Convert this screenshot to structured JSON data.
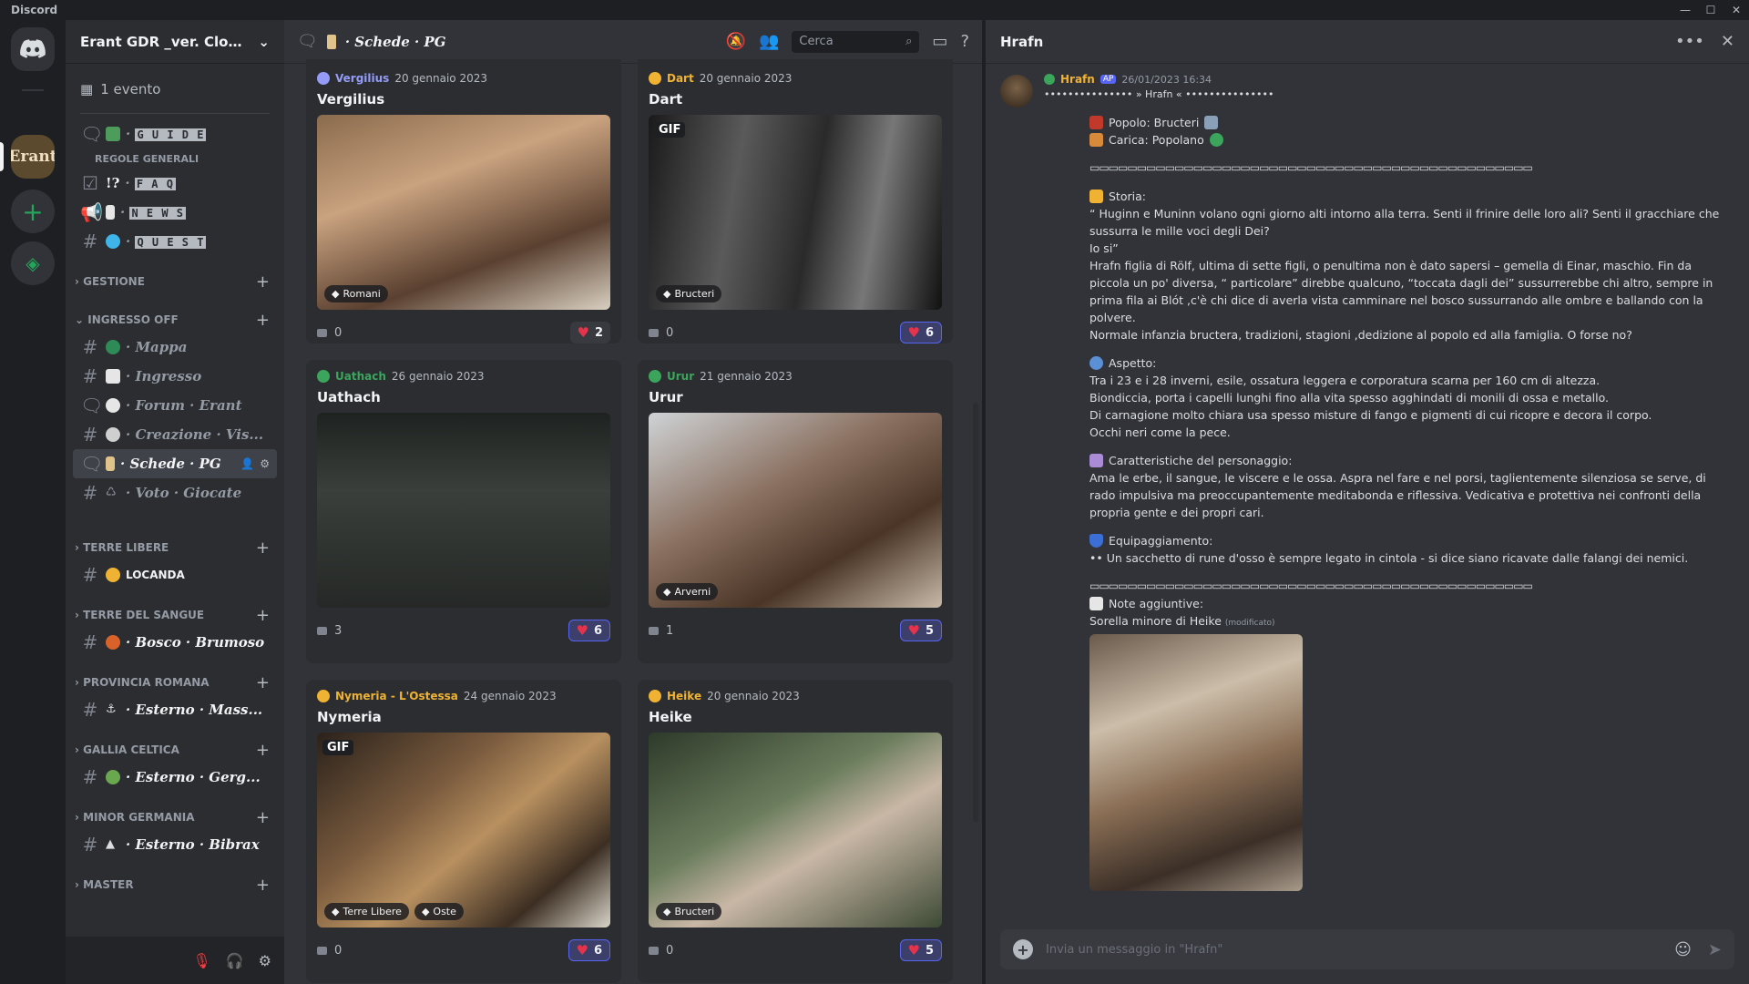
{
  "app": {
    "name": "Discord"
  },
  "window_controls": [
    "—",
    "☐",
    "✕"
  ],
  "server_sidebar": {
    "active_server_label": "Erant"
  },
  "guild": {
    "name": "Erant GDR _ver. Closed_...",
    "event": "1 evento"
  },
  "channels": {
    "top": [
      {
        "id": "guide",
        "label": "G U I D E",
        "sub": "REGOLE GENERALI"
      },
      {
        "id": "faq",
        "label": "F A Q",
        "prefix": "!?"
      },
      {
        "id": "news",
        "label": "N E W S"
      },
      {
        "id": "quest",
        "label": "Q U E S T"
      }
    ],
    "categories": [
      {
        "id": "gestione",
        "label": "GESTIONE",
        "items": []
      },
      {
        "id": "ingresso",
        "label": "INGRESSO OFF",
        "items": [
          {
            "label": "· Mappa",
            "type": "text"
          },
          {
            "label": "· Ingresso",
            "type": "text"
          },
          {
            "label": "· Forum · Erant",
            "type": "forum"
          },
          {
            "label": "· Creazione · Vis...",
            "type": "text"
          },
          {
            "label": "· Schede · PG",
            "type": "forum",
            "selected": true
          },
          {
            "label": "· Voto · Giocate",
            "type": "text"
          }
        ]
      },
      {
        "id": "terre-libere",
        "label": "TERRE LIBERE",
        "items": [
          {
            "label": "LOCANDA",
            "type": "text",
            "plain": true
          }
        ]
      },
      {
        "id": "terre-sangue",
        "label": "TERRE DEL SANGUE",
        "items": [
          {
            "label": "· Bosco · Brumoso",
            "type": "text"
          }
        ]
      },
      {
        "id": "provincia",
        "label": "PROVINCIA ROMANA",
        "items": [
          {
            "label": "· Esterno · Mass...",
            "type": "text"
          }
        ]
      },
      {
        "id": "gallia",
        "label": "GALLIA CELTICA",
        "items": [
          {
            "label": "· Esterno · Gerg...",
            "type": "text"
          }
        ]
      },
      {
        "id": "germania",
        "label": "MINOR GERMANIA",
        "items": [
          {
            "label": "· Esterno · Bibrax",
            "type": "text"
          }
        ]
      },
      {
        "id": "master",
        "label": "MASTER",
        "items": []
      }
    ]
  },
  "forum": {
    "title": "· Schede · PG",
    "search_placeholder": "Cerca",
    "posts": [
      {
        "author": "Vergilius",
        "author_color": "#949cf7",
        "date": "20 gennaio 2023",
        "title": "Vergilius",
        "tags": [
          "Romani"
        ],
        "comments": "0",
        "reactions": "2",
        "reacted": false,
        "gif": false,
        "img": "linear-gradient(160deg,#8a6b4d 0%,#c9a27f 35%,#5a4030 70%,#d8cfc0 100%)"
      },
      {
        "author": "Dart",
        "author_color": "#f0b232",
        "date": "20 gennaio 2023",
        "title": "Dart",
        "tags": [
          "Bructeri"
        ],
        "comments": "0",
        "reactions": "6",
        "reacted": true,
        "gif": true,
        "img": "linear-gradient(100deg,#1a1a1a 0%,#5a5a5a 30%,#2a2a2a 55%,#777 75%,#111 100%)"
      },
      {
        "author": "Uathach",
        "author_color": "#3ba55c",
        "date": "26 gennaio 2023",
        "title": "Uathach",
        "tags": [],
        "comments": "3",
        "reactions": "6",
        "reacted": true,
        "gif": false,
        "img": "linear-gradient(180deg,#1e2220 0%,#3a3f3b 40%,#252826 100%)"
      },
      {
        "author": "Urur",
        "author_color": "#3ba55c",
        "date": "21 gennaio 2023",
        "title": "Urur",
        "tags": [
          "Arverni"
        ],
        "comments": "1",
        "reactions": "5",
        "reacted": true,
        "gif": false,
        "img": "linear-gradient(150deg,#cfd3d6 0%,#8a7060 40%,#4a3526 70%,#c7b9a8 100%)"
      },
      {
        "author": "Nymeria - L'Ostessa",
        "author_color": "#f0b232",
        "date": "24 gennaio 2023",
        "title": "Nymeria",
        "tags": [
          "Terre Libere",
          "Oste"
        ],
        "comments": "0",
        "reactions": "6",
        "reacted": true,
        "gif": true,
        "img": "linear-gradient(140deg,#2b221b 0%,#7a5b3e 35%,#b89060 55%,#3c2e22 80%,#d9d4c8 100%)"
      },
      {
        "author": "Heike",
        "author_color": "#f0b232",
        "date": "20 gennaio 2023",
        "title": "Heike",
        "tags": [
          "Bructeri"
        ],
        "comments": "0",
        "reactions": "5",
        "reacted": true,
        "gif": false,
        "img": "linear-gradient(150deg,#2e3a2a 0%,#6b7d5d 40%,#c9b7a6 60%,#3d4a35 100%)"
      }
    ]
  },
  "thread": {
    "title": "Hrafn",
    "author": "Hrafn",
    "op_badge": "AP",
    "timestamp": "26/01/2023 16:34",
    "banner": "••••••••••••••• » Hrafn « •••••••••••••••",
    "popolo": "Popolo: Bructeri",
    "carica": "Carica: Popolano",
    "separator": "▭▭▭▭▭▭▭▭▭▭▭▭▭▭▭▭▭▭▭▭▭▭▭▭▭▭▭▭▭▭▭▭▭▭▭▭▭▭▭▭▭▭▭▭▭▭▭",
    "storia_label": "Storia:",
    "storia": [
      "“ Huginn e Muninn volano ogni giorno alti intorno alla terra. Senti il frinire delle loro ali? Senti il gracchiare che sussurra le mille voci degli Dei?",
      "Io si”",
      "Hrafn figlia di Rölf, ultima di sette figli, o penultima non è dato sapersi – gemella di Einar, maschio. Fin da piccola un po' diversa, “ particolare” direbbe qualcuno, “toccata dagli dei” sussurrerebbe chi altro, sempre in prima fila ai Blót ,c'è chi dice di averla vista camminare nel bosco sussurrando alle ombre e ballando con la polvere.",
      "Normale infanzia bructera, tradizioni, stagioni ,dedizione al popolo ed alla famiglia. O forse no?"
    ],
    "aspetto_label": "Aspetto:",
    "aspetto": [
      "Tra i 23 e i 28 inverni, esile, ossatura leggera e corporatura scarna per 160 cm di altezza.",
      "Biondiccia, porta i capelli lunghi fino alla vita spesso agghindati di monili di ossa e metallo.",
      "Di carnagione molto chiara usa spesso misture di fango e pigmenti di cui ricopre e decora il corpo.",
      "Occhi neri come la pece."
    ],
    "caratteristiche_label": "Caratteristiche del personaggio:",
    "caratteristiche": "Ama le erbe, il sangue, le viscere e le ossa. Aspra nel fare e nel porsi, taglientemente silenziosa se serve, di rado impulsiva ma preoccupantemente meditabonda e riflessiva. Vedicativa e protettiva nei confronti della propria gente e dei propri cari.",
    "equip_label": "Equipaggiamento:",
    "equip": "•• Un sacchetto di rune d'osso è sempre legato in cintola - si dice siano ricavate dalle falangi dei nemici.",
    "note_label": "Note aggiuntive:",
    "note": "Sorella minore di Heike",
    "edited": "(modificato)",
    "composer_placeholder": "Invia un messaggio in \"Hrafn\""
  },
  "colors": {
    "accent": "#5865f2",
    "green": "#23a55a",
    "heart": "#e5334b",
    "op_name": "#f0b232"
  }
}
